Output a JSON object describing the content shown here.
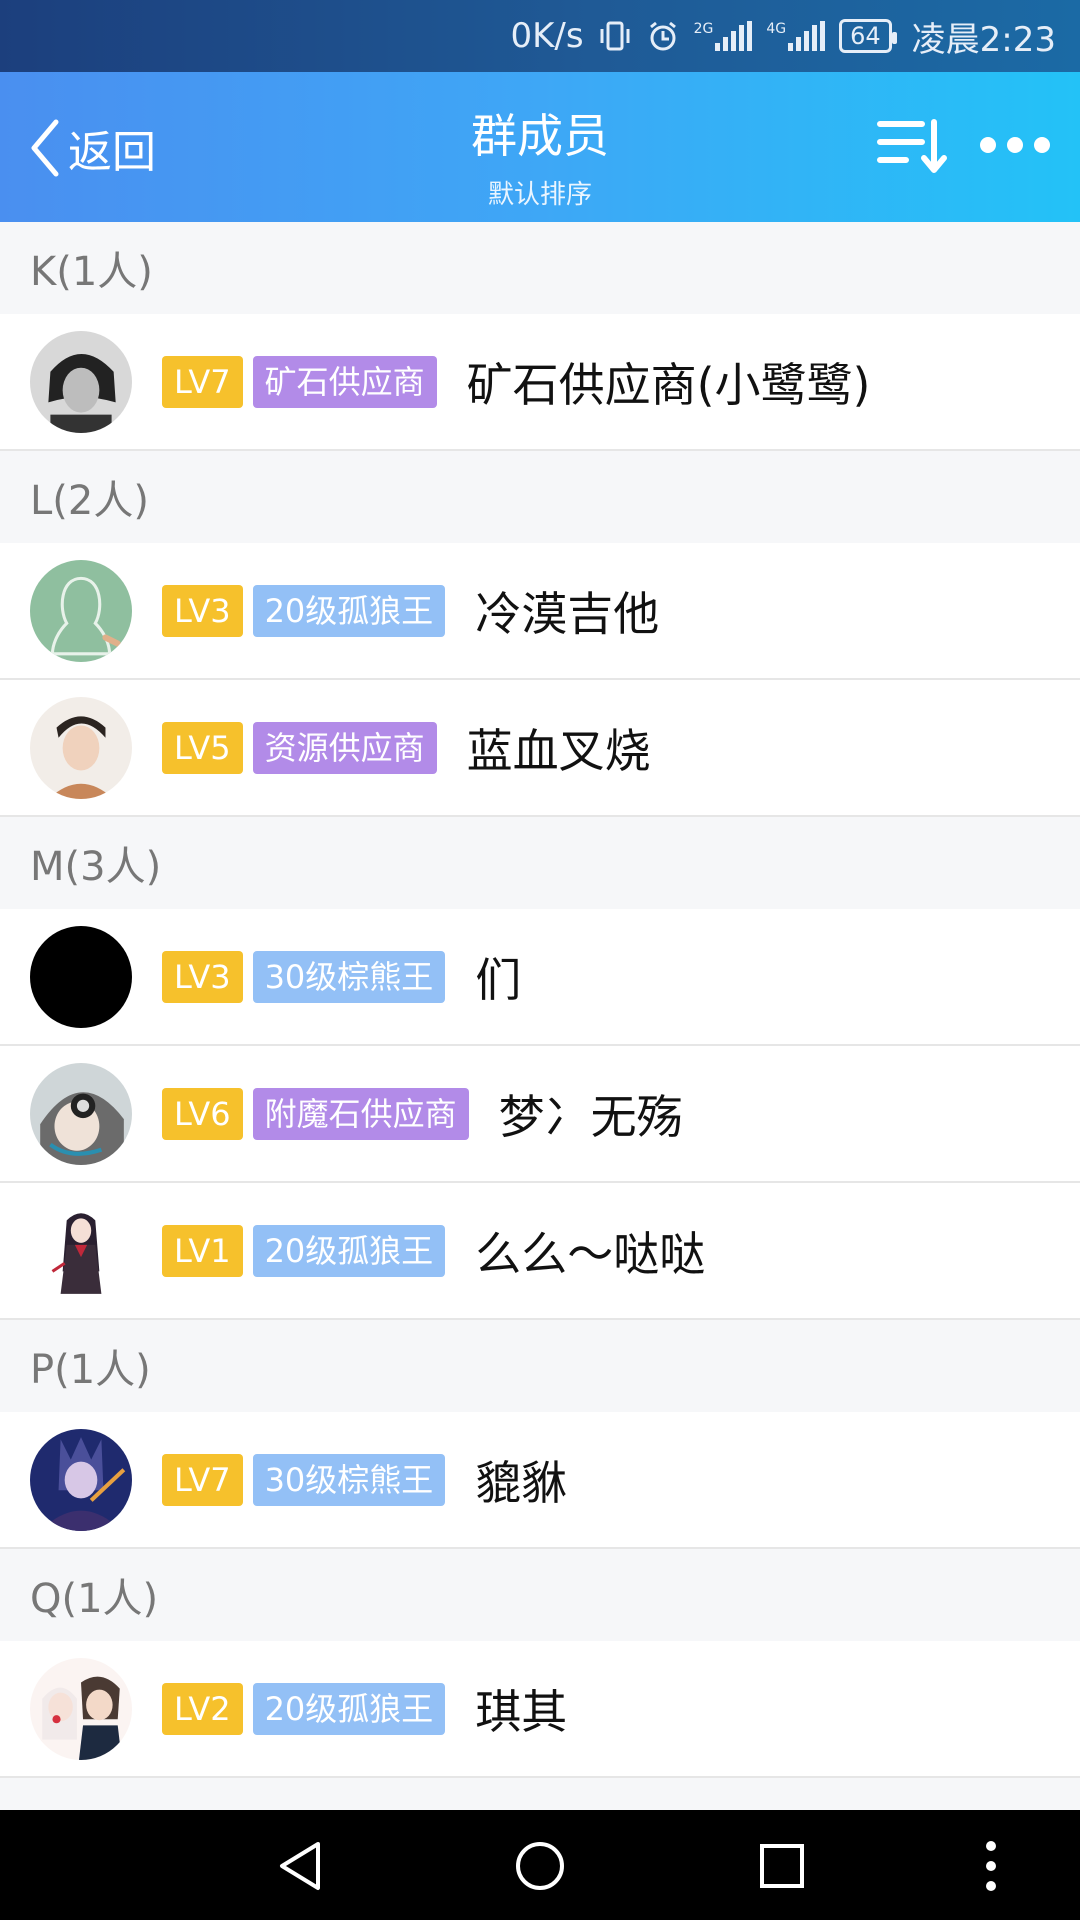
{
  "status_bar": {
    "net_speed": "0K/s",
    "net_2g": "2G",
    "net_4g": "4G",
    "battery": "64",
    "time": "凌晨2:23",
    "icons": [
      "vibrate-icon",
      "alarm-icon",
      "signal-icon",
      "signal-icon",
      "battery-icon"
    ]
  },
  "header": {
    "back_label": "返回",
    "title": "群成员",
    "subtitle": "默认排序",
    "colors": {
      "start": "#4a8ff0",
      "end": "#23c2f7"
    }
  },
  "sections": [
    {
      "label": "K(1人)",
      "members": [
        {
          "level": "LV7",
          "tag": "矿石供应商",
          "tag_color": "purple",
          "name": "矿石供应商(小鹭鹭)",
          "avatar": "avatar-photo-dark"
        }
      ]
    },
    {
      "label": "L(2人)",
      "members": [
        {
          "level": "LV3",
          "tag": "20级孤狼王",
          "tag_color": "blue",
          "name": "冷漠吉他",
          "avatar": "avatar-default-green"
        },
        {
          "level": "LV5",
          "tag": "资源供应商",
          "tag_color": "purple",
          "name": "蓝血叉烧",
          "avatar": "avatar-photo-light"
        }
      ]
    },
    {
      "label": "M(3人)",
      "members": [
        {
          "level": "LV3",
          "tag": "30级棕熊王",
          "tag_color": "blue",
          "name": "们",
          "avatar": "avatar-black"
        },
        {
          "level": "LV6",
          "tag": "附魔石供应商",
          "tag_color": "purple",
          "name": "梦冫无殇",
          "avatar": "avatar-anime-headphones"
        },
        {
          "level": "LV1",
          "tag": "20级孤狼王",
          "tag_color": "blue",
          "name": "么么～哒哒",
          "avatar": "avatar-anime-girl"
        }
      ]
    },
    {
      "label": "P(1人)",
      "members": [
        {
          "level": "LV7",
          "tag": "30级棕熊王",
          "tag_color": "blue",
          "name": "貔貅",
          "avatar": "avatar-game-hero"
        }
      ]
    },
    {
      "label": "Q(1人)",
      "members": [
        {
          "level": "LV2",
          "tag": "20级孤狼王",
          "tag_color": "blue",
          "name": "琪其",
          "avatar": "avatar-anime-couple"
        }
      ]
    }
  ],
  "colors": {
    "level_badge": "#f6c12c",
    "tag_purple": "#b28be8",
    "tag_blue": "#93c0f6"
  },
  "nav_bar": {
    "icons": [
      "back-triangle-icon",
      "home-circle-icon",
      "recents-square-icon",
      "more-vertical-icon"
    ]
  }
}
